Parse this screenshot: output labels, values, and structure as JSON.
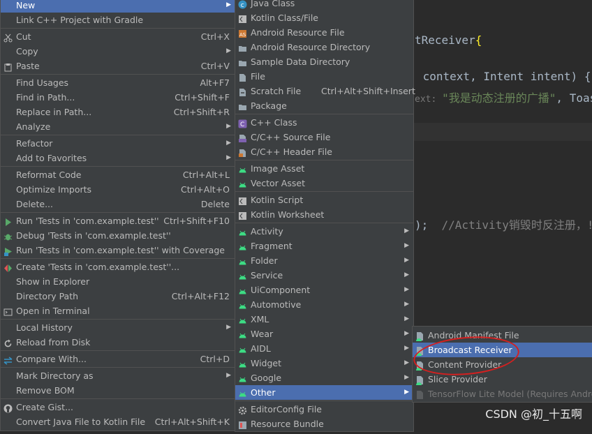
{
  "editor": {
    "line1": "tReceiver",
    "line1_brace": "{",
    "line2_a": " context, Intent intent) {",
    "line3_hint": "ext: ",
    "line3_str": "\"我是动态注册的广播\"",
    "line3_rest": ", Toas",
    "line4_paren": ");  ",
    "line4_comment": "//Activity销毁时反注册，!"
  },
  "menu1": [
    {
      "label": "New",
      "shortcut": "",
      "submenu": true,
      "selected": true
    },
    {
      "label": "Link C++ Project with Gradle",
      "shortcut": "",
      "submenu": false
    },
    {
      "label": "Cut",
      "shortcut": "Ctrl+X",
      "icon": "scissors-icon"
    },
    {
      "label": "Copy",
      "shortcut": "",
      "submenu": true
    },
    {
      "label": "Paste",
      "shortcut": "Ctrl+V",
      "icon": "clipboard-icon"
    },
    {
      "label": "Find Usages",
      "shortcut": "Alt+F7"
    },
    {
      "label": "Find in Path...",
      "shortcut": "Ctrl+Shift+F"
    },
    {
      "label": "Replace in Path...",
      "shortcut": "Ctrl+Shift+R"
    },
    {
      "label": "Analyze",
      "shortcut": "",
      "submenu": true
    },
    {
      "label": "Refactor",
      "shortcut": "",
      "submenu": true
    },
    {
      "label": "Add to Favorites",
      "shortcut": "",
      "submenu": true
    },
    {
      "label": "Reformat Code",
      "shortcut": "Ctrl+Alt+L"
    },
    {
      "label": "Optimize Imports",
      "shortcut": "Ctrl+Alt+O"
    },
    {
      "label": "Delete...",
      "shortcut": "Delete"
    },
    {
      "label": "Run 'Tests in 'com.example.test''",
      "shortcut": "Ctrl+Shift+F10",
      "icon": "run-icon"
    },
    {
      "label": "Debug 'Tests in 'com.example.test''",
      "shortcut": "",
      "icon": "debug-icon"
    },
    {
      "label": "Run 'Tests in 'com.example.test'' with Coverage",
      "shortcut": "",
      "icon": "coverage-icon"
    },
    {
      "label": "Create 'Tests in 'com.example.test''...",
      "shortcut": "",
      "icon": "create-test-icon"
    },
    {
      "label": "Show in Explorer",
      "shortcut": ""
    },
    {
      "label": "Directory Path",
      "shortcut": "Ctrl+Alt+F12"
    },
    {
      "label": "Open in Terminal",
      "shortcut": "",
      "icon": "terminal-icon"
    },
    {
      "label": "Local History",
      "shortcut": "",
      "submenu": true
    },
    {
      "label": "Reload from Disk",
      "shortcut": "",
      "icon": "reload-icon"
    },
    {
      "label": "Compare With...",
      "shortcut": "Ctrl+D",
      "icon": "compare-icon"
    },
    {
      "label": "Mark Directory as",
      "shortcut": "",
      "submenu": true
    },
    {
      "label": "Remove BOM",
      "shortcut": ""
    },
    {
      "label": "Create Gist...",
      "shortcut": "",
      "icon": "github-icon"
    },
    {
      "label": "Convert Java File to Kotlin File",
      "shortcut": "Ctrl+Alt+Shift+K"
    }
  ],
  "menu2": [
    {
      "label": "Java Class",
      "shortcut": ""
    },
    {
      "label": "Kotlin Class/File",
      "shortcut": ""
    },
    {
      "label": "Android Resource File",
      "shortcut": ""
    },
    {
      "label": "Android Resource Directory",
      "shortcut": ""
    },
    {
      "label": "Sample Data Directory",
      "shortcut": ""
    },
    {
      "label": "File",
      "shortcut": ""
    },
    {
      "label": "Scratch File",
      "shortcut": "Ctrl+Alt+Shift+Insert"
    },
    {
      "label": "Package",
      "shortcut": ""
    },
    {
      "label": "C++ Class",
      "shortcut": ""
    },
    {
      "label": "C/C++ Source File",
      "shortcut": ""
    },
    {
      "label": "C/C++ Header File",
      "shortcut": ""
    },
    {
      "label": "Image Asset",
      "shortcut": ""
    },
    {
      "label": "Vector Asset",
      "shortcut": ""
    },
    {
      "label": "Kotlin Script",
      "shortcut": ""
    },
    {
      "label": "Kotlin Worksheet",
      "shortcut": ""
    },
    {
      "label": "Activity",
      "submenu": true
    },
    {
      "label": "Fragment",
      "submenu": true
    },
    {
      "label": "Folder",
      "submenu": true
    },
    {
      "label": "Service",
      "submenu": true
    },
    {
      "label": "UiComponent",
      "submenu": true
    },
    {
      "label": "Automotive",
      "submenu": true
    },
    {
      "label": "XML",
      "submenu": true
    },
    {
      "label": "Wear",
      "submenu": true
    },
    {
      "label": "AIDL",
      "submenu": true
    },
    {
      "label": "Widget",
      "submenu": true
    },
    {
      "label": "Google",
      "submenu": true
    },
    {
      "label": "Other",
      "submenu": true,
      "selected": true
    },
    {
      "label": "EditorConfig File"
    },
    {
      "label": "Resource Bundle"
    }
  ],
  "menu3": [
    {
      "label": "Android Manifest File"
    },
    {
      "label": "Broadcast Receiver",
      "selected": true
    },
    {
      "label": "Content Provider"
    },
    {
      "label": "Slice Provider"
    },
    {
      "label": "TensorFlow Lite Model (Requires Androi",
      "disabled": true
    }
  ],
  "watermark": "CSDN @初_十五啊",
  "colors": {
    "menu_bg": "#3c3f41",
    "selection": "#4b6eaf",
    "android_green": "#3ddc84",
    "annotation_red": "#d42020"
  }
}
